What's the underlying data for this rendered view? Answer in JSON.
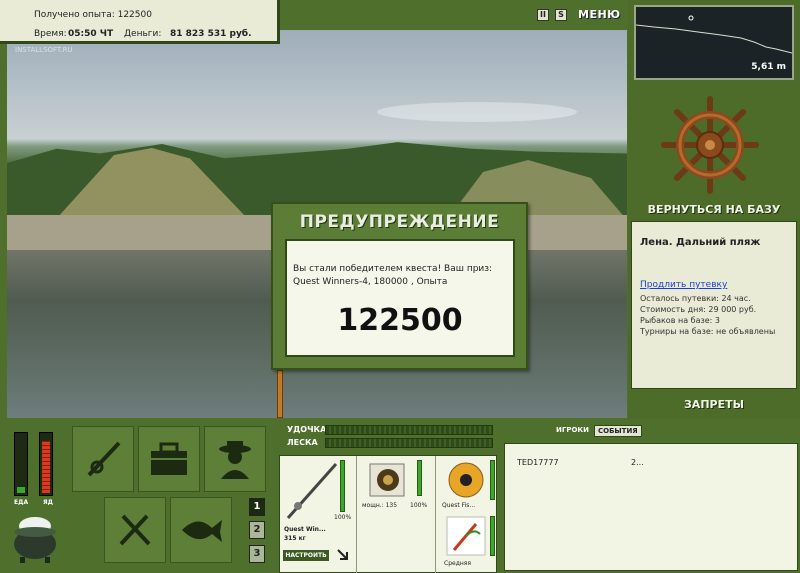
{
  "info": {
    "xp_label": "Получено опыта: 122500",
    "time_label": "Время:",
    "time_value": "05:50 ЧТ",
    "money_label": "Деньги:",
    "money_value": "81 823 531 руб."
  },
  "toolbar": {
    "pause_label": "II",
    "sound_label": "S",
    "menu_label": "МЕНЮ"
  },
  "scene": {
    "watermark": "INSTALLSOFT.RU"
  },
  "dialog": {
    "title": "ПРЕДУПРЕЖДЕНИЕ",
    "message": "Вы стали победителем квеста! Ваш приз: Quest Winners-4, 180000 , Опыта",
    "xp": "122500"
  },
  "depth": {
    "value": "5,61 m"
  },
  "base": {
    "return_label": "ВЕРНУТЬСЯ НА БАЗУ",
    "location": "Лена. Дальний пляж",
    "extend_link": "Продлить путевку",
    "lines": [
      "Осталось путевки: 24 час.",
      "Стоимость дня: 29 000 руб.",
      "Рыбаков на базе: 3",
      "Турниры на базе: не объявлены"
    ],
    "bans_label": "ЗАПРЕТЫ"
  },
  "status": {
    "food_label": "ЕДА",
    "poison_label": "ЯД",
    "food_level": 0.1,
    "poison_level": 0.9,
    "pages": [
      "1",
      "2",
      "3"
    ],
    "active_page": "1"
  },
  "tackle": {
    "rod_label": "УДОЧКА",
    "line_label": "ЛЕСКА",
    "rod_name": "Quest Win...",
    "rod_weight": "315 кг",
    "rod_pct": "100%",
    "reel_power": "мощн.: 135",
    "reel_pct": "100%",
    "line_name": "Quest Fis...",
    "lure_name": "Средняя",
    "setup_label": "НАСТРОИТЬ"
  },
  "players": {
    "tab_players": "ИГРОКИ",
    "tab_events": "СОБЫТИЯ",
    "rows": [
      {
        "name": "TED17777",
        "value": "2..."
      }
    ]
  },
  "colors": {
    "panel_green": "#4f6f2d",
    "panel_light": "#e9ebd6",
    "link_blue": "#1a3fd0",
    "poison_red": "#d83a22",
    "food_green": "#3ea62a"
  }
}
